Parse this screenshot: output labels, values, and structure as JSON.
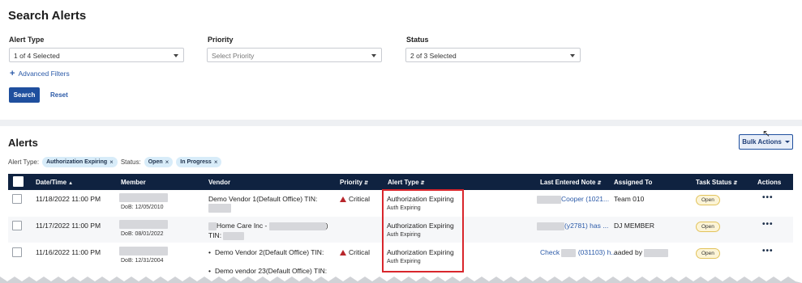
{
  "search": {
    "title": "Search Alerts",
    "alert_type_label": "Alert Type",
    "alert_type_value": "1 of 4 Selected",
    "priority_label": "Priority",
    "priority_placeholder": "Select Priority",
    "status_label": "Status",
    "status_value": "2 of 3 Selected",
    "advanced_filters": "Advanced Filters",
    "search_button": "Search",
    "reset_button": "Reset"
  },
  "alerts": {
    "title": "Alerts",
    "bulk_actions": "Bulk Actions",
    "filter_alert_type_label": "Alert Type:",
    "filter_alert_type_chip": "Authorization Expiring",
    "filter_status_label": "Status:",
    "filter_status_chips": [
      "Open",
      "In Progress"
    ],
    "columns": {
      "datetime": "Date/Time",
      "member": "Member",
      "vendor": "Vendor",
      "priority": "Priority",
      "alert_type": "Alert Type",
      "last_note": "Last Entered Note",
      "assigned_to": "Assigned To",
      "task_status": "Task Status",
      "actions": "Actions"
    },
    "rows": [
      {
        "datetime": "11/18/2022 11:00 PM",
        "dob": "DoB: 12/05/2010",
        "vendor": "Demo Vendor 1(Default Office) TIN:",
        "priority": "Critical",
        "alert_type": "Authorization Expiring",
        "alert_sub": "Auth Expiring",
        "note": "Cooper (1021...",
        "assigned": "Team 010",
        "status": "Open",
        "actions": "•••"
      },
      {
        "datetime": "11/17/2022 11:00 PM",
        "dob": "DoB: 08/01/2022",
        "vendor": "Home Care Inc -",
        "vendor_close": ")",
        "vendor_tin": "TIN:",
        "priority": "",
        "alert_type": "Authorization Expiring",
        "alert_sub": "Auth Expiring",
        "note": "(y2781) has ...",
        "assigned": "DJ MEMBER",
        "status": "Open",
        "actions": "•••"
      },
      {
        "datetime": "11/16/2022 11:00 PM",
        "dob": "DoB: 12/31/2004",
        "vendor": "Demo Vendor 2(Default Office) TIN:",
        "vendor2": "Demo vendor 23(Default Office) TIN:",
        "priority": "Critical",
        "alert_type": "Authorization Expiring",
        "alert_sub": "Auth Expiring",
        "note_prefix": "Check",
        "note": "(031103) h...",
        "assigned": "aaded by",
        "status": "Open",
        "actions": "•••"
      }
    ]
  },
  "colors": {
    "header_bg": "#0f2240",
    "primary": "#1f4f9e",
    "link": "#2b5aa8",
    "critical": "#b8262b",
    "highlight": "#d9262c"
  }
}
